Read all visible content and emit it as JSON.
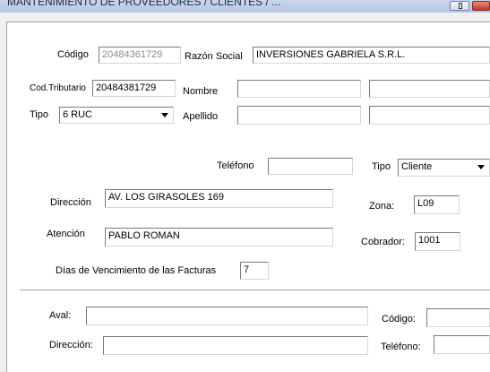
{
  "window": {
    "title": "MANTENIMIENTO DE PROVEEDORES / CLIENTES / ..."
  },
  "form": {
    "codigo": {
      "label": "Código",
      "value": "20484361729"
    },
    "razon_social": {
      "label": "Razón Social",
      "value": "INVERSIONES GABRIELA S.R.L."
    },
    "cod_tributario": {
      "label": "Cod.Tributario",
      "value": "20484381729"
    },
    "nombre": {
      "label": "Nombre",
      "value_1": "",
      "value_2": ""
    },
    "tipo_doc": {
      "label": "Tipo",
      "value": "6 RUC"
    },
    "apellido": {
      "label": "Apellido",
      "value_1": "",
      "value_2": ""
    },
    "telefono": {
      "label": "Teléfono",
      "value": ""
    },
    "tipo_cliente": {
      "label": "Tipo",
      "value": "Cliente"
    },
    "direccion": {
      "label": "Dirección",
      "value": "AV. LOS GIRASOLES  169"
    },
    "zona": {
      "label": "Zona:",
      "value": "L09"
    },
    "atencion": {
      "label": "Atención",
      "value": "PABLO ROMAN"
    },
    "cobrador": {
      "label": "Cobrador:",
      "value": "1001"
    },
    "dias_vencimiento": {
      "label": "Días de Vencimiento de las Facturas",
      "value": "7"
    },
    "aval": {
      "label": "Aval:",
      "value": ""
    },
    "aval_codigo": {
      "label": "Código:",
      "value": ""
    },
    "aval_direccion": {
      "label": "Dirección:",
      "value": ""
    },
    "aval_telefono": {
      "label": "Teléfono:",
      "value": ""
    }
  },
  "icons": [
    "minimize-icon",
    "close-icon",
    "chevron-down-icon"
  ],
  "colors": {
    "titlebar": "#c2d2ea",
    "close": "#c2382a",
    "panel": "#ffffff"
  }
}
